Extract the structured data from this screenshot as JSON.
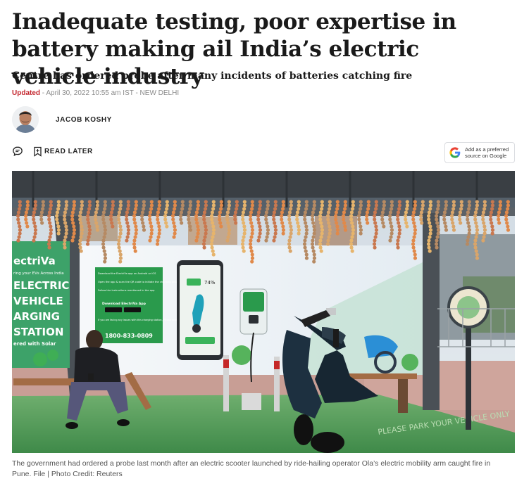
{
  "article": {
    "headline": "Inadequate testing, poor expertise in battery making ail India’s electric vehicle industry",
    "subheadline": "Centre has ordered probe after many incidents of batteries catching fire",
    "updated_label": "Updated",
    "dateline": " - April 30, 2022 10:55 am IST - NEW DELHI",
    "author": "JACOB KOSHY",
    "read_later": "READ LATER",
    "google_pref": "Add as a preferred source on Google",
    "caption": "The government had ordered a probe last month after an electric scooter launched by ride-hailing operator Ola’s electric mobility arm caught fire in Pune. File | Photo Credit: Reuters"
  },
  "photo": {
    "billboard_left": [
      "ectriVa",
      "ELECTRIC",
      "VEHICLE",
      "ARGING",
      "STATION",
      "ered with Solar"
    ],
    "billboard_tag": "ring your EVs Across India",
    "panel_steps": [
      "Download the ElectriVa app on Android or iOS",
      "Open the app & scan the QR code to initiate the charging process",
      "Follow the instructions mentioned in the app"
    ],
    "panel_button": "Download ElectriVa App",
    "panel_help": "If you are facing any issues with this charging station, Please contact ElectriVa customer support",
    "panel_phone": "1800-833-0809",
    "phone_battery": "74%",
    "floor_text": "PLEASE PARK YOUR VEHICLE ONLY"
  },
  "icons": {
    "comment": "comment-icon",
    "bookmark": "bookmark-icon",
    "google": "google-logo-icon"
  },
  "colors": {
    "updated_red": "#c3262e",
    "brand_green": "#2e9d48",
    "floor_green": "#4c9a53"
  }
}
